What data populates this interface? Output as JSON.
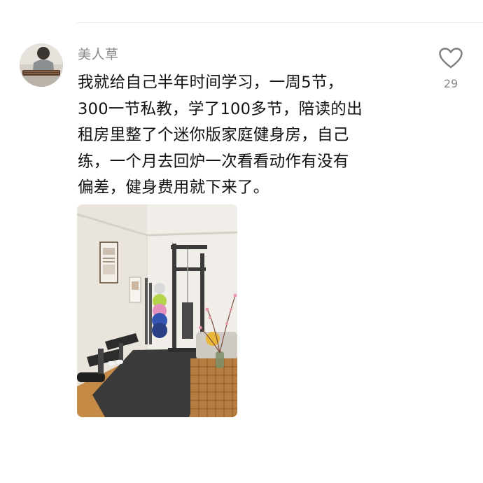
{
  "comment": {
    "author": "美人草",
    "lines": [
      "我就给自己半年时间学习，一周5节，",
      "300一节私教，学了100多节，陪读的出",
      "租房里整了个迷你版家庭健身房，自己",
      "练，一个月去回炉一次看看动作有没有",
      "偏差，健身费用就下来了。"
    ],
    "like_count": "29"
  },
  "icons": {
    "like": "heart-outline-icon"
  },
  "colors": {
    "username": "#8a8a8a",
    "text": "#111111",
    "icon": "#8a8a8a"
  }
}
